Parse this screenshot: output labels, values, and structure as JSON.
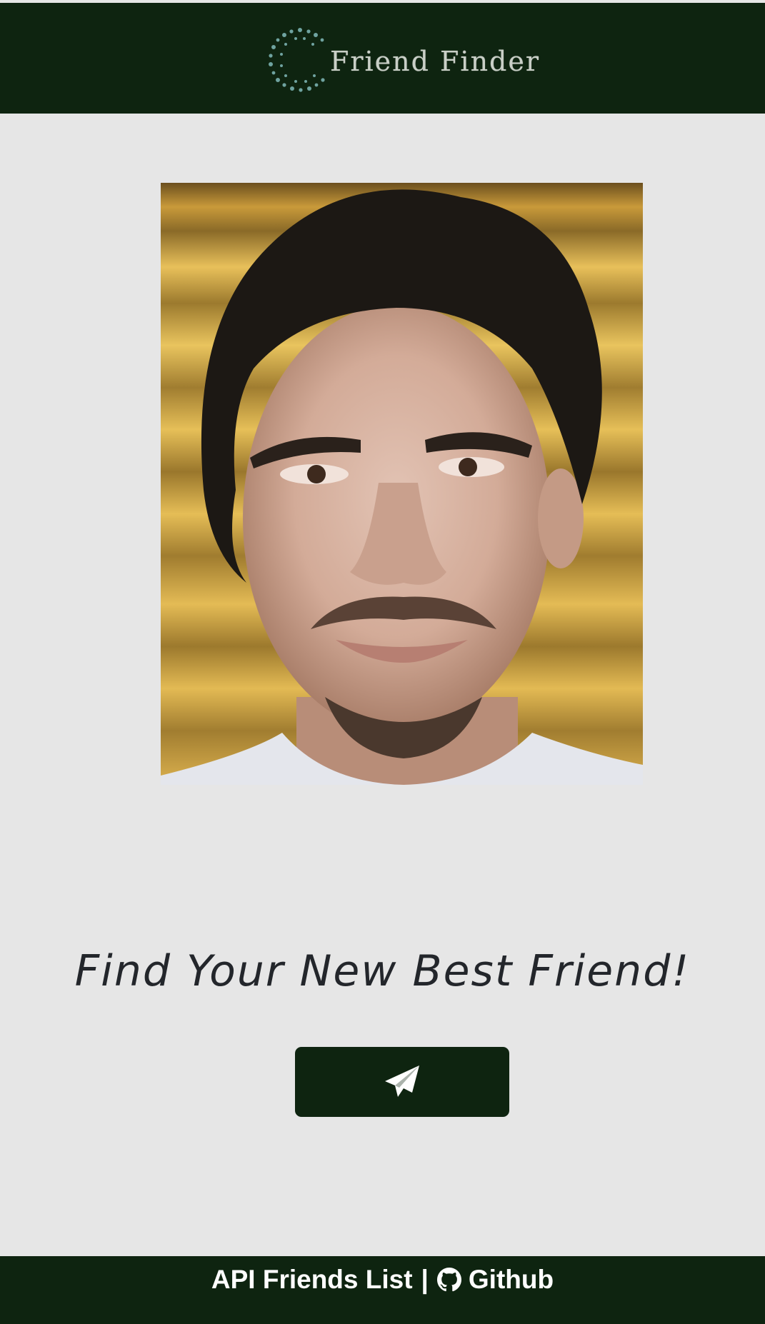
{
  "header": {
    "brand": "Friend Finder",
    "logo_icon": "dotted-ring-logo",
    "background": "#0e2410",
    "brand_color": "#c9cfc7",
    "dot_color": "#6fa3a0"
  },
  "hero": {
    "photo_alt": "Portrait photo of a young man",
    "tagline": "Find Your New Best Friend!"
  },
  "send_button": {
    "icon": "paper-plane-icon",
    "color": "#0e2410"
  },
  "footer": {
    "api_link": "API Friends List",
    "separator": "|",
    "github_icon": "github-icon",
    "github_link": "Github"
  }
}
